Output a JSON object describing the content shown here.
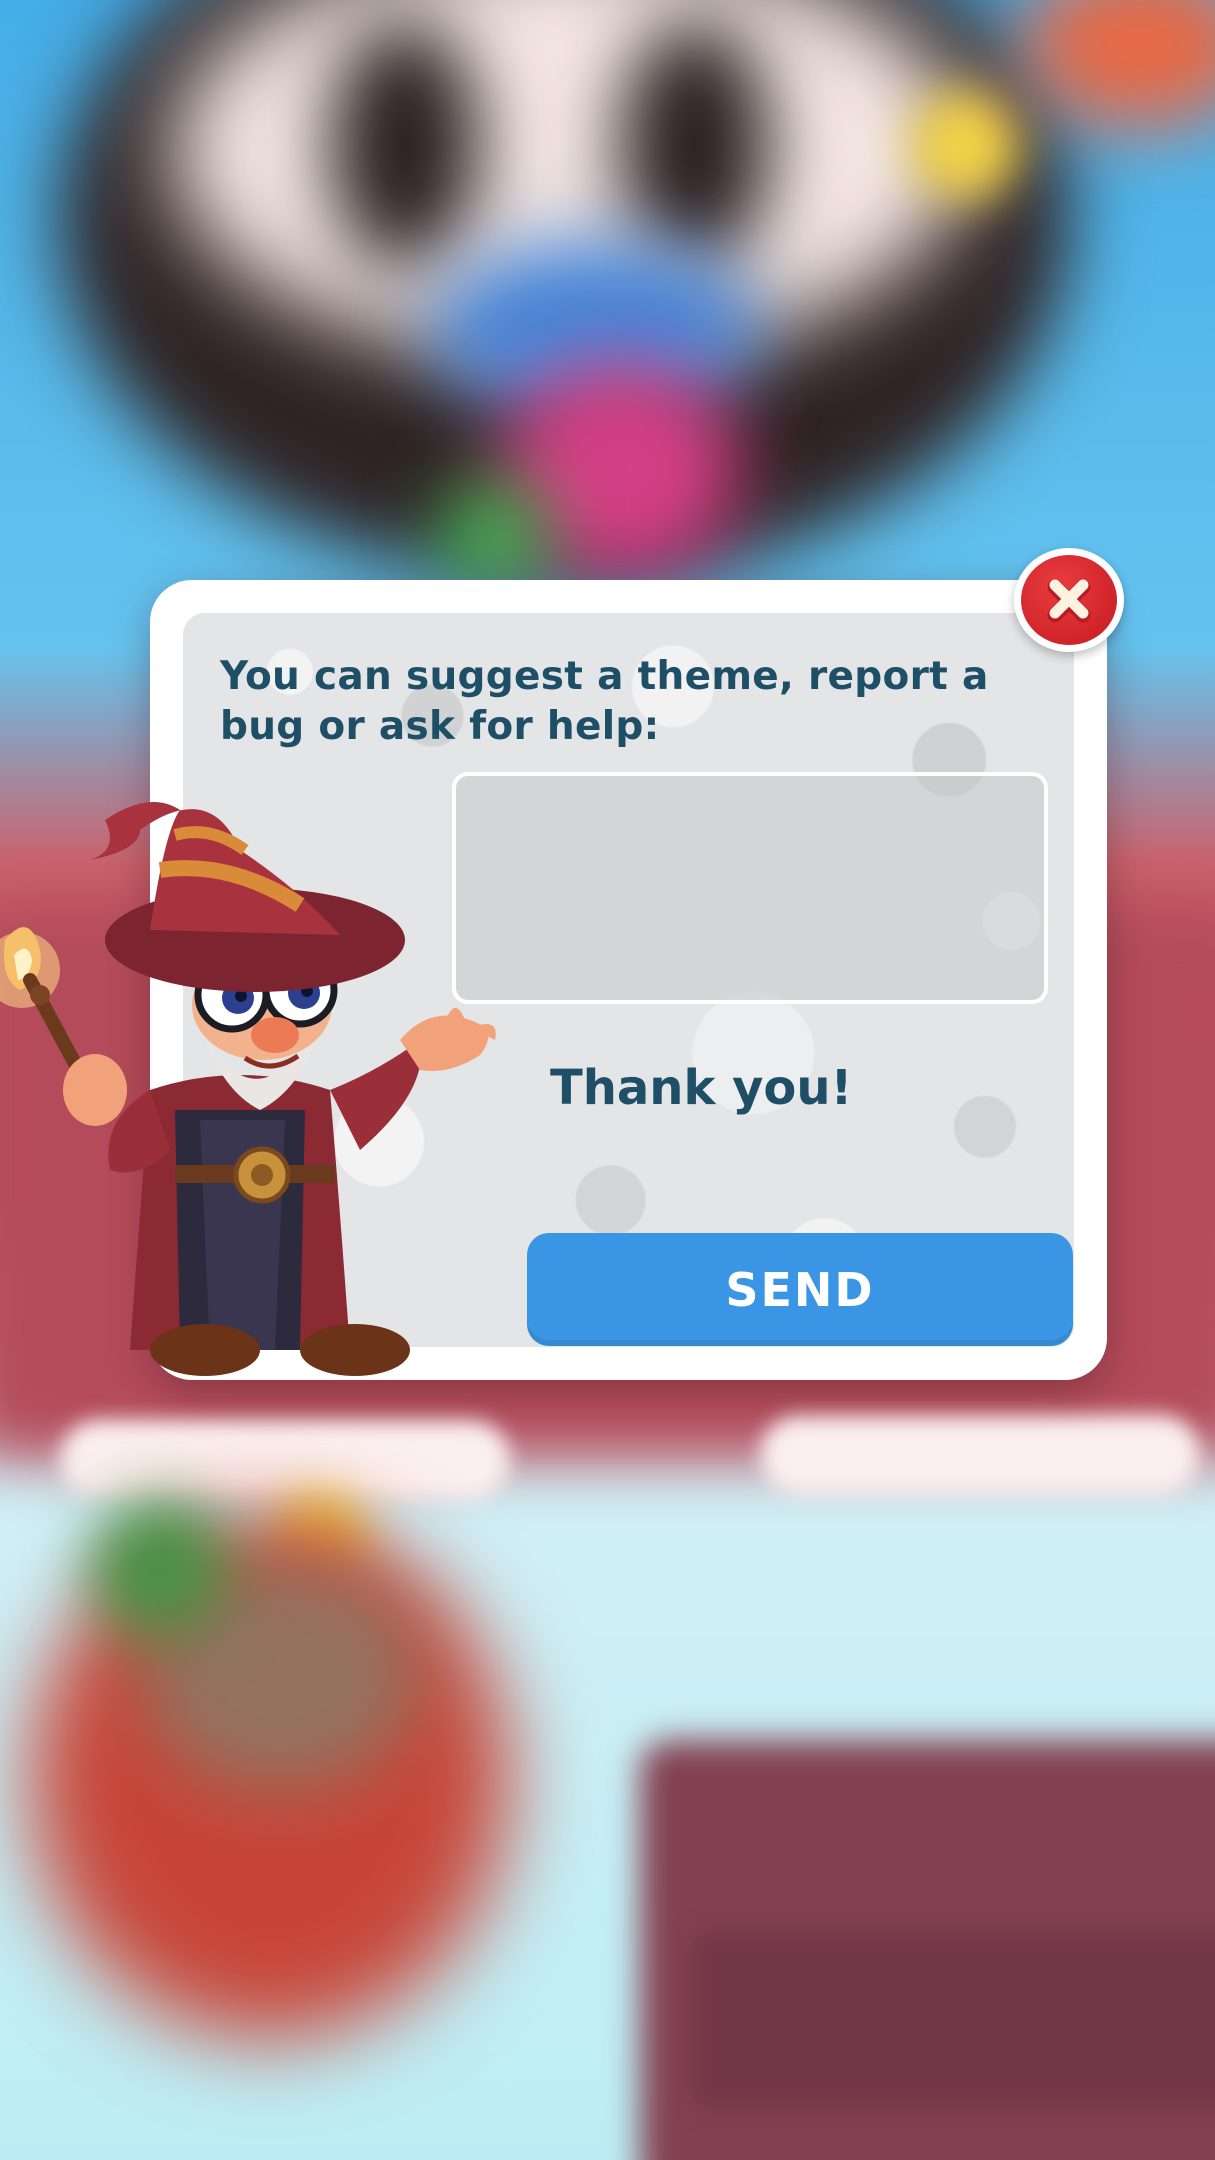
{
  "dialog": {
    "prompt": "You can suggest a theme, report a bug or ask for help:",
    "message_value": "",
    "message_placeholder": "",
    "thanks_text": "Thank you!",
    "send_label": "SEND"
  },
  "colors": {
    "text": "#1f4f67",
    "send_button": "#3a96e4",
    "close_button": "#d0242a",
    "panel": "#e4e5e6"
  },
  "icons": {
    "close": "close-icon",
    "mascot": "wizard-mascot-icon"
  }
}
